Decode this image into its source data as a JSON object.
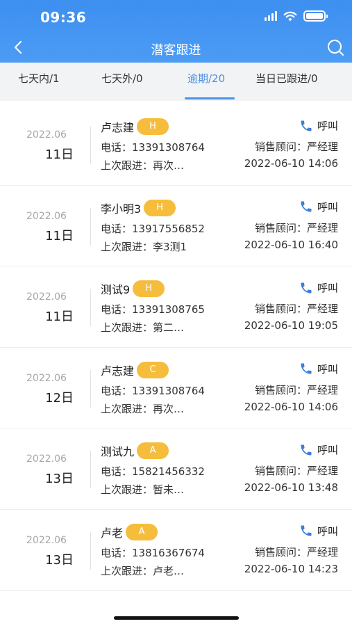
{
  "status_bar": {
    "time": "09:36"
  },
  "nav": {
    "title": "潜客跟进"
  },
  "tabs": [
    {
      "label": "七天内/1",
      "active": false
    },
    {
      "label": "七天外/0",
      "active": false
    },
    {
      "label": "逾期/20",
      "active": true
    },
    {
      "label": "当日已跟进/0",
      "active": false
    }
  ],
  "colors": {
    "accent": "#4a90e2",
    "header": "#4c9cf5",
    "badge": "#f5bd3b"
  },
  "items": [
    {
      "year_month": "2022.06",
      "day": "11日",
      "name": "卢志建",
      "level": "H",
      "phone": "电话：13391308764",
      "last_follow": "上次跟进：再次…",
      "call_label": "呼叫",
      "advisor": "销售顾问：严经理",
      "datetime": "2022-06-10 14:06"
    },
    {
      "year_month": "2022.06",
      "day": "11日",
      "name": "李小明3",
      "level": "H",
      "phone": "电话：13917556852",
      "last_follow": "上次跟进：李3测1",
      "call_label": "呼叫",
      "advisor": "销售顾问：严经理",
      "datetime": "2022-06-10 16:40"
    },
    {
      "year_month": "2022.06",
      "day": "11日",
      "name": "测试9",
      "level": "H",
      "phone": "电话：13391308765",
      "last_follow": "上次跟进：第二…",
      "call_label": "呼叫",
      "advisor": "销售顾问：严经理",
      "datetime": "2022-06-10 19:05"
    },
    {
      "year_month": "2022.06",
      "day": "12日",
      "name": "卢志建",
      "level": "C",
      "phone": "电话：13391308764",
      "last_follow": "上次跟进：再次…",
      "call_label": "呼叫",
      "advisor": "销售顾问：严经理",
      "datetime": "2022-06-10 14:06"
    },
    {
      "year_month": "2022.06",
      "day": "13日",
      "name": "测试九",
      "level": "A",
      "phone": "电话：15821456332",
      "last_follow": "上次跟进：暂未…",
      "call_label": "呼叫",
      "advisor": "销售顾问：严经理",
      "datetime": "2022-06-10 13:48"
    },
    {
      "year_month": "2022.06",
      "day": "13日",
      "name": "卢老",
      "level": "A",
      "phone": "电话：13816367674",
      "last_follow": "上次跟进：卢老…",
      "call_label": "呼叫",
      "advisor": "销售顾问：严经理",
      "datetime": "2022-06-10 14:23"
    }
  ]
}
